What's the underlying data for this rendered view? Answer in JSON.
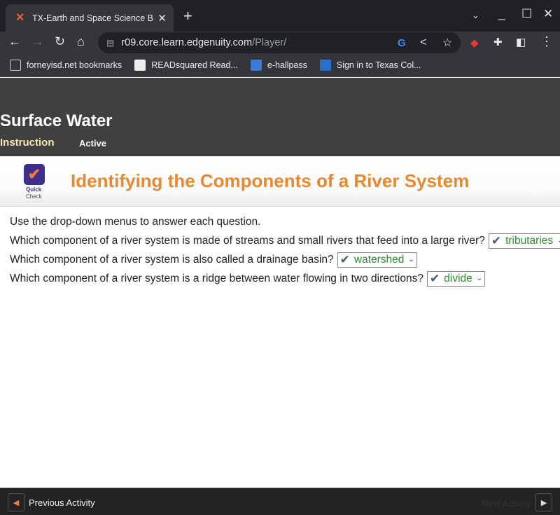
{
  "browser": {
    "tab_title": "TX-Earth and Space Science B - E",
    "url_host": "r09.core.learn.edgenuity.com",
    "url_path": "/Player/",
    "bookmarks": [
      {
        "label": "forneyisd.net bookmarks",
        "icon": "folder-icon"
      },
      {
        "label": "READsquared Read...",
        "icon": "readsquared-icon"
      },
      {
        "label": "e-hallpass",
        "icon": "ehallpass-icon"
      },
      {
        "label": "Sign in to Texas Col...",
        "icon": "texas-college-icon"
      }
    ]
  },
  "header": {
    "lesson_title": "Surface Water",
    "section": "Instruction",
    "status": "Active"
  },
  "activity": {
    "badge_line1": "Quick",
    "badge_line2": "Check",
    "title": "Identifying the Components of a River System"
  },
  "questions": {
    "instructions": "Use the drop-down menus to answer each question.",
    "items": [
      {
        "text": "Which component of a river system is made of streams and small rivers that feed into a large river?",
        "answer": "tributaries",
        "correct": true
      },
      {
        "text": "Which component of a river system is also called a drainage basin?",
        "answer": "watershed",
        "correct": true
      },
      {
        "text": "Which component of a river system is a ridge between water flowing in two directions?",
        "answer": "divide",
        "correct": true
      }
    ]
  },
  "footer": {
    "prev_label": "Previous Activity",
    "next_label": "Next Activity"
  },
  "colors": {
    "accent_orange": "#e8892f",
    "correct_green": "#2e8b2e",
    "badge_purple": "#3e2f8c"
  }
}
